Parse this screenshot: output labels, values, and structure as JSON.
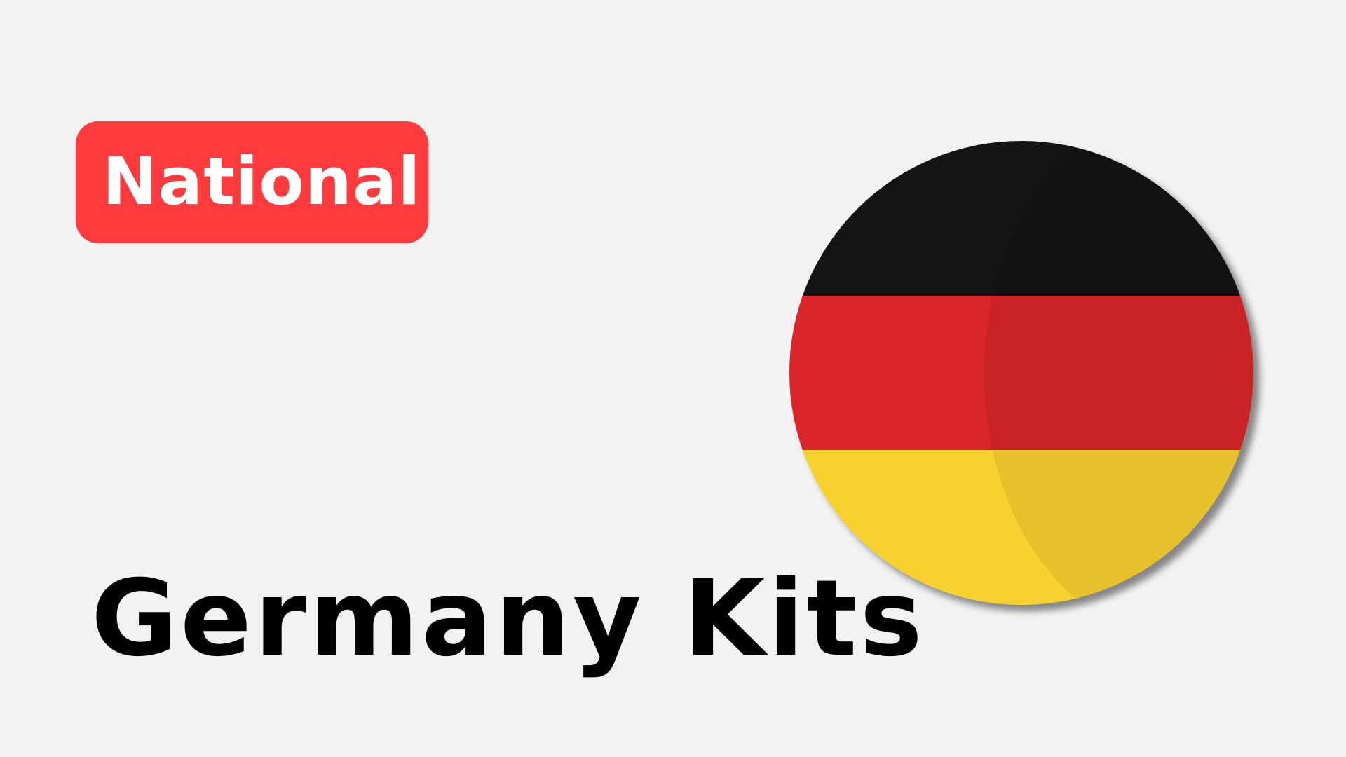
{
  "badge": {
    "label": "National",
    "color": "#ff3b3d",
    "text_color": "#ffffff"
  },
  "headline": {
    "text": "Germany Kits",
    "color": "#000000"
  },
  "flag": {
    "icon": "germany-flag-icon",
    "stripes": [
      {
        "name": "black",
        "color": "#141414"
      },
      {
        "name": "red",
        "color": "#da2628"
      },
      {
        "name": "gold",
        "color": "#f7d12f"
      }
    ]
  },
  "background_color": "#f2f2f2"
}
